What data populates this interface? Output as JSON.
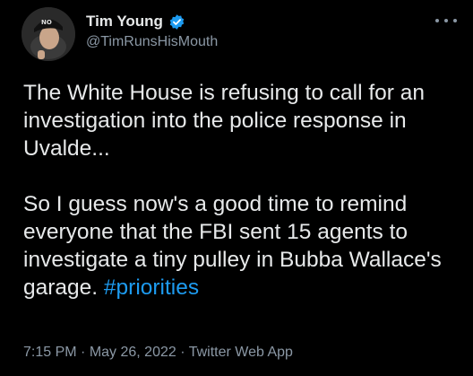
{
  "tweet": {
    "author": {
      "display_name": "Tim Young",
      "handle": "@TimRunsHisMouth",
      "verified_icon": "verified-badge-icon",
      "avatar_text": "NO"
    },
    "more_icon": "more-options-icon",
    "paragraphs": {
      "first": "The White House is refusing to call for an investigation into the police response in Uvalde...",
      "second_text": "So I guess now's a good time to remind everyone that the FBI sent 15 agents to investigate a tiny pulley in Bubba Wallace's garage. ",
      "second_hashtag": "#priorities"
    },
    "meta": {
      "time": "7:15 PM",
      "separator": " · ",
      "date": "May 26, 2022",
      "source": "Twitter Web App"
    },
    "colors": {
      "background": "#000000",
      "text": "#e7e9ea",
      "secondary": "#8b98a5",
      "link": "#1d9bf0"
    }
  }
}
